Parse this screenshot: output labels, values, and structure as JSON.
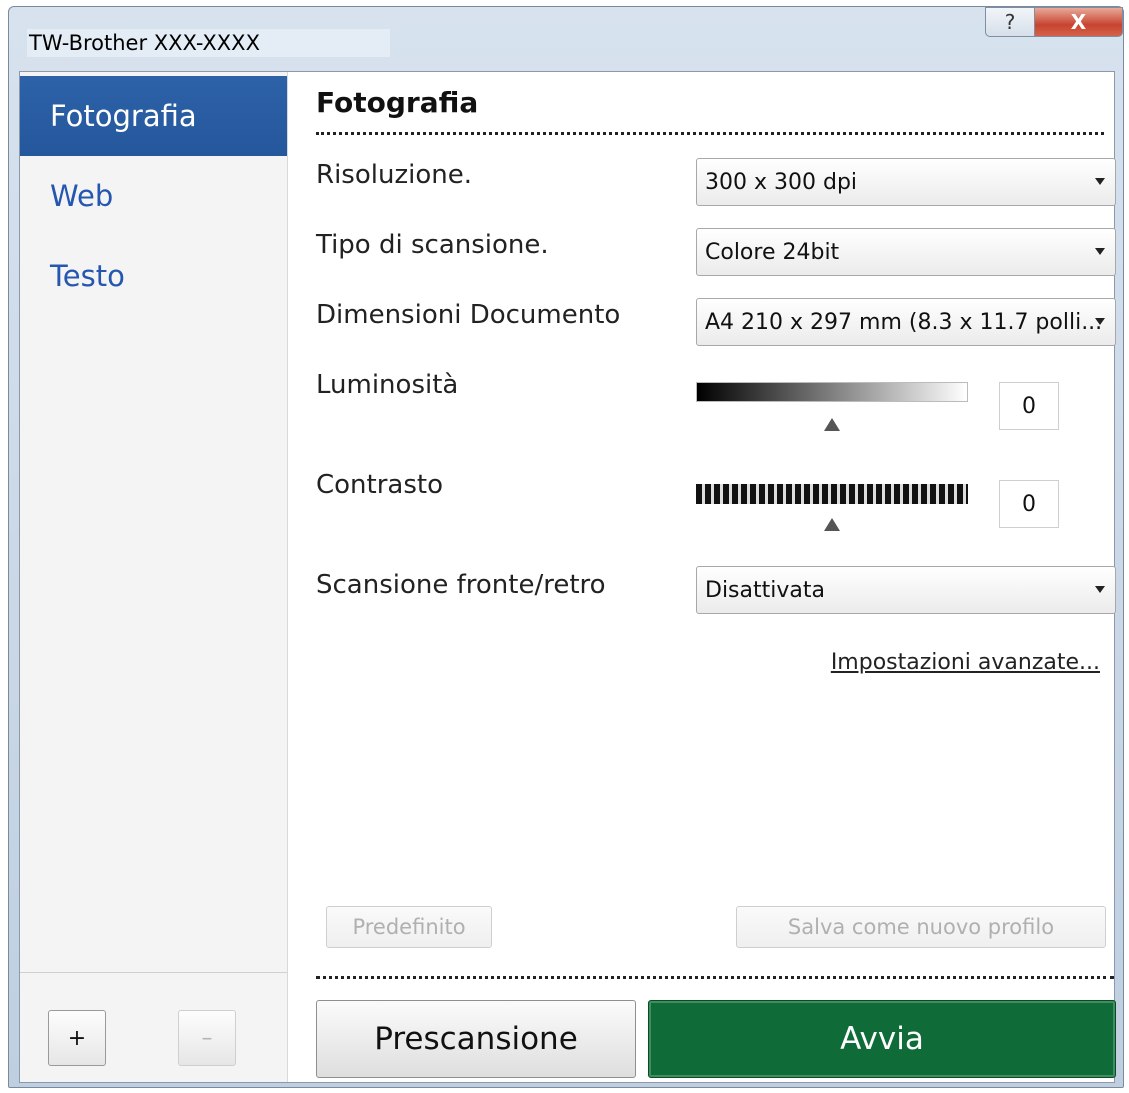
{
  "window": {
    "title": "TW-Brother  XXX-XXXX",
    "help_label": "?",
    "close_label": "X"
  },
  "sidebar": {
    "items": [
      {
        "label": "Fotografia",
        "active": true
      },
      {
        "label": "Web",
        "active": false
      },
      {
        "label": "Testo",
        "active": false
      }
    ],
    "add_label": "+",
    "remove_label": "–"
  },
  "main": {
    "section_title": "Fotografia",
    "resolution": {
      "label": "Risoluzione.",
      "value": "300 x 300 dpi"
    },
    "scan_type": {
      "label": "Tipo di scansione.",
      "value": "Colore 24bit"
    },
    "doc_size": {
      "label": "Dimensioni Documento",
      "value": "A4 210 x 297 mm (8.3 x 11.7 polli..."
    },
    "brightness": {
      "label": "Luminosità",
      "value": "0"
    },
    "contrast": {
      "label": "Contrasto",
      "value": "0"
    },
    "duplex": {
      "label": "Scansione fronte/retro",
      "value": "Disattivata"
    },
    "advanced_link": "Impostazioni avanzate...",
    "default_button": "Predefinito",
    "save_profile_button": "Salva come nuovo profilo",
    "prescan_button": "Prescansione",
    "start_button": "Avvia"
  },
  "colors": {
    "sidebar_active": "#2a5ea3",
    "sidebar_link": "#2557b0",
    "start_button": "#0f6b37"
  }
}
